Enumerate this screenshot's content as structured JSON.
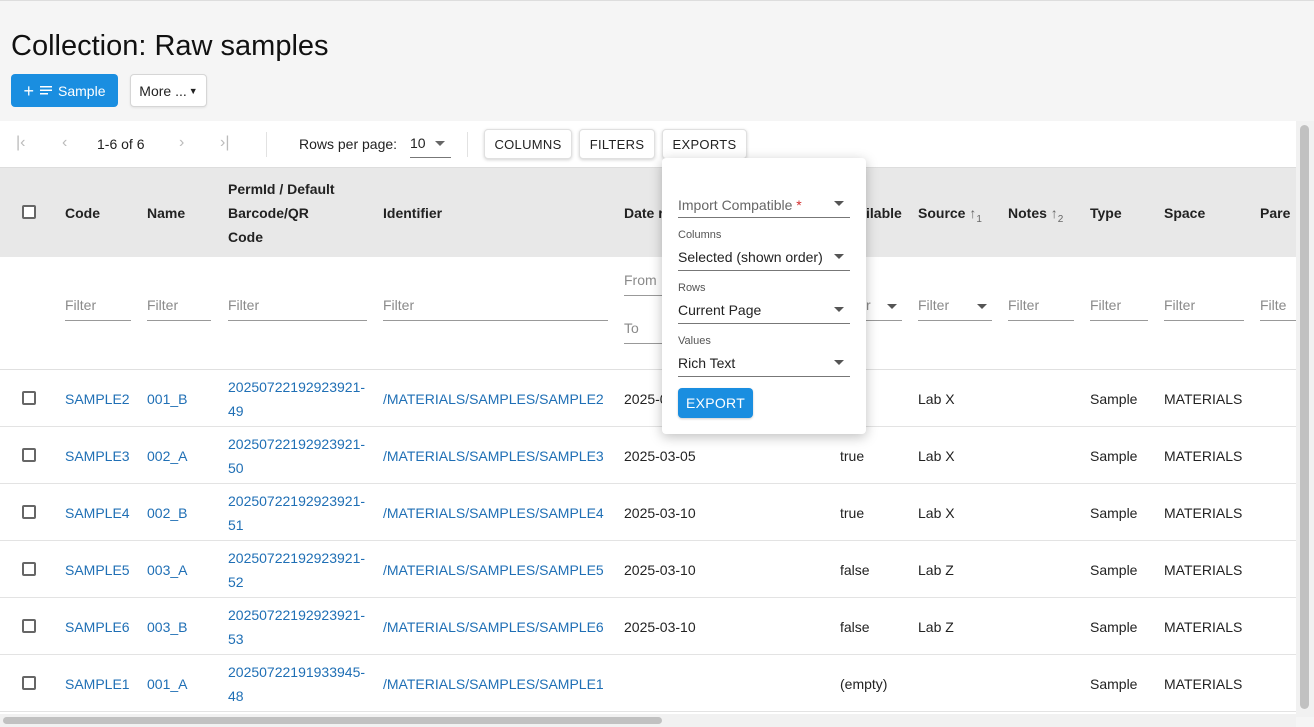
{
  "page": {
    "title": "Collection: Raw samples"
  },
  "actions": {
    "add_sample_label": "Sample",
    "more_label": "More ..."
  },
  "pagination": {
    "range_text": "1-6 of 6",
    "rows_per_page_label": "Rows per page:",
    "rows_per_page_value": "10"
  },
  "toolbar": {
    "columns_label": "COLUMNS",
    "filters_label": "FILTERS",
    "exports_label": "EXPORTS"
  },
  "columns": {
    "code": "Code",
    "name": "Name",
    "permid_line1": "PermId / Default",
    "permid_line2": "Barcode/QR",
    "permid_line3": "Code",
    "identifier": "Identifier",
    "date_partial": "Date r",
    "available_partial": "ilable",
    "source": "Source",
    "source_sort": "↑",
    "source_sort_order": "1",
    "notes": "Notes",
    "notes_sort": "↑",
    "notes_sort_order": "2",
    "type": "Type",
    "space": "Space",
    "parents_partial": "Pare"
  },
  "filters": {
    "placeholder": "Filter",
    "from_label": "From",
    "to_label": "To",
    "available_partial": "r",
    "parents_partial": "Filte"
  },
  "rows": [
    {
      "code": "SAMPLE2",
      "name": "001_B",
      "permid_1": "20250722192923921-",
      "permid_2": "49",
      "identifier": "/MATERIALS/SAMPLES/SAMPLE2",
      "date": "2025-0",
      "available": "",
      "source": "Lab X",
      "notes": "",
      "type": "Sample",
      "space": "MATERIALS"
    },
    {
      "code": "SAMPLE3",
      "name": "002_A",
      "permid_1": "20250722192923921-",
      "permid_2": "50",
      "identifier": "/MATERIALS/SAMPLES/SAMPLE3",
      "date": "2025-03-05",
      "available": "true",
      "source": "Lab X",
      "notes": "",
      "type": "Sample",
      "space": "MATERIALS"
    },
    {
      "code": "SAMPLE4",
      "name": "002_B",
      "permid_1": "20250722192923921-",
      "permid_2": "51",
      "identifier": "/MATERIALS/SAMPLES/SAMPLE4",
      "date": "2025-03-10",
      "available": "true",
      "source": "Lab X",
      "notes": "",
      "type": "Sample",
      "space": "MATERIALS"
    },
    {
      "code": "SAMPLE5",
      "name": "003_A",
      "permid_1": "20250722192923921-",
      "permid_2": "52",
      "identifier": "/MATERIALS/SAMPLES/SAMPLE5",
      "date": "2025-03-10",
      "available": "false",
      "source": "Lab Z",
      "notes": "",
      "type": "Sample",
      "space": "MATERIALS"
    },
    {
      "code": "SAMPLE6",
      "name": "003_B",
      "permid_1": "20250722192923921-",
      "permid_2": "53",
      "identifier": "/MATERIALS/SAMPLES/SAMPLE6",
      "date": "2025-03-10",
      "available": "false",
      "source": "Lab Z",
      "notes": "",
      "type": "Sample",
      "space": "MATERIALS"
    },
    {
      "code": "SAMPLE1",
      "name": "001_A",
      "permid_1": "20250722191933945-",
      "permid_2": "48",
      "identifier": "/MATERIALS/SAMPLES/SAMPLE1",
      "date": "",
      "available": "(empty)",
      "source": "",
      "notes": "",
      "type": "Sample",
      "space": "MATERIALS"
    }
  ],
  "export_popup": {
    "mode_label": "Import Compatible",
    "required_mark": "*",
    "columns_label": "Columns",
    "columns_value": "Selected (shown order)",
    "rows_label": "Rows",
    "rows_value": "Current Page",
    "values_label": "Values",
    "values_value": "Rich Text",
    "export_button": "EXPORT"
  },
  "colors": {
    "primary": "#1a8ee0",
    "link": "#1f6fb5",
    "header_bg": "#e8e8e8",
    "required": "#d32f2f"
  }
}
